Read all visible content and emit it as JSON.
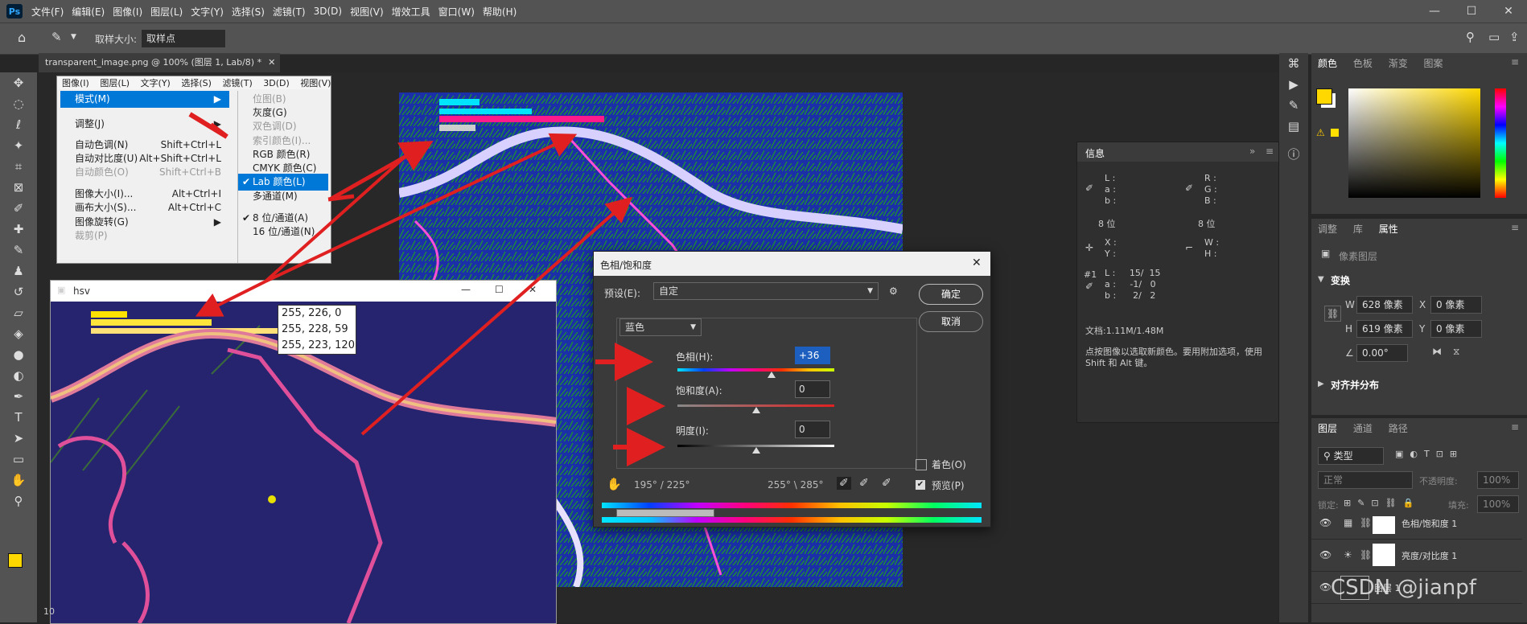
{
  "app": {
    "logo": "Ps",
    "menus": [
      "文件(F)",
      "编辑(E)",
      "图像(I)",
      "图层(L)",
      "文字(Y)",
      "选择(S)",
      "滤镜(T)",
      "3D(D)",
      "视图(V)",
      "增效工具",
      "窗口(W)",
      "帮助(H)"
    ]
  },
  "options_bar": {
    "sample_size_label": "取样大小:",
    "sample_size_value": "取样点"
  },
  "document_tab": {
    "title": "transparent_image.png @ 100% (图层 1, Lab/8) *"
  },
  "image_menu": {
    "menubar": [
      "图像(I)",
      "图层(L)",
      "文字(Y)",
      "选择(S)",
      "滤镜(T)",
      "3D(D)",
      "视图(V)"
    ],
    "items": [
      {
        "label": "模式(M)",
        "shortcut": "",
        "highlight": true
      },
      {
        "label": "调整(J)",
        "shortcut": ""
      },
      {
        "label": "自动色调(N)",
        "shortcut": "Shift+Ctrl+L"
      },
      {
        "label": "自动对比度(U)",
        "shortcut": "Alt+Shift+Ctrl+L"
      },
      {
        "label": "自动颜色(O)",
        "shortcut": "Shift+Ctrl+B",
        "disabled": true
      },
      {
        "label": "图像大小(I)...",
        "shortcut": "Alt+Ctrl+I"
      },
      {
        "label": "画布大小(S)...",
        "shortcut": "Alt+Ctrl+C"
      },
      {
        "label": "图像旋转(G)",
        "shortcut": ""
      },
      {
        "label": "裁剪(P)",
        "shortcut": "",
        "disabled": true
      }
    ],
    "mode_submenu": [
      {
        "label": "位图(B)",
        "disabled": true
      },
      {
        "label": "灰度(G)"
      },
      {
        "label": "双色调(D)",
        "disabled": true
      },
      {
        "label": "索引颜色(I)...",
        "disabled": true
      },
      {
        "label": "RGB 颜色(R)"
      },
      {
        "label": "CMYK 颜色(C)"
      },
      {
        "label": "Lab 颜色(L)",
        "checked": true,
        "highlight": true
      },
      {
        "label": "多通道(M)"
      },
      {
        "label": "8 位/通道(A)",
        "checked": true
      },
      {
        "label": "16 位/通道(N)"
      }
    ]
  },
  "hsv_window": {
    "title": "hsv",
    "tooltip": [
      "255, 226, 0",
      "255, 228, 59",
      "255, 223, 120"
    ]
  },
  "hue_sat_dialog": {
    "title": "色相/饱和度",
    "preset_label": "预设(E):",
    "preset_value": "自定",
    "channel": "蓝色",
    "hue_label": "色相(H):",
    "hue_value": "+36",
    "hue_fraction": 0.6,
    "sat_label": "饱和度(A):",
    "sat_value": "0",
    "sat_fraction": 0.5,
    "light_label": "明度(I):",
    "light_value": "0",
    "light_fraction": 0.5,
    "range_left": "195° / 225°",
    "range_right": "255° \\ 285°",
    "ok": "确定",
    "cancel": "取消",
    "colorize": "着色(O)",
    "preview": "预览(P)"
  },
  "info_panel": {
    "title": "信息",
    "lab_labels": [
      "L :",
      "a :",
      "b :"
    ],
    "rgb_labels": [
      "R :",
      "G :",
      "B :"
    ],
    "bits_left": "8 位",
    "bits_right": "8 位",
    "xy_labels": [
      "X :",
      "Y :"
    ],
    "wh_labels": [
      "W :",
      "H :"
    ],
    "sample_id": "#1",
    "sample_rows": [
      "L :     15/  15",
      "a :     -1/   0",
      "b :      2/   2"
    ],
    "doc_size": "文档:1.11M/1.48M",
    "hint": "点按图像以选取新颜色。要用附加选项，使用 Shift 和 Alt 键。"
  },
  "color_panel": {
    "tabs": [
      "颜色",
      "色板",
      "渐变",
      "图案"
    ],
    "fg_color": "#ffd800",
    "bg_color": "#ffffff"
  },
  "properties_panel": {
    "tabs": [
      "调整",
      "库",
      "属性"
    ],
    "type": "像素图层",
    "transform_title": "变换",
    "w_label": "W",
    "w_value": "628 像素",
    "x_label": "X",
    "x_value": "0 像素",
    "h_label": "H",
    "h_value": "619 像素",
    "y_label": "Y",
    "y_value": "0 像素",
    "angle": "0.00°",
    "align_title": "对齐并分布"
  },
  "layers_panel": {
    "tabs": [
      "图层",
      "通道",
      "路径"
    ],
    "filter": "类型",
    "blend": "正常",
    "opacity_label": "不透明度:",
    "opacity": "100%",
    "lock_label": "锁定:",
    "fill_label": "填充:",
    "fill": "100%",
    "layers": [
      {
        "name": "色相/饱和度 1"
      },
      {
        "name": "亮度/对比度 1"
      },
      {
        "name": "图层 1"
      }
    ]
  },
  "watermark": "CSDN @jianpf",
  "status": {
    "zoom": "10"
  }
}
